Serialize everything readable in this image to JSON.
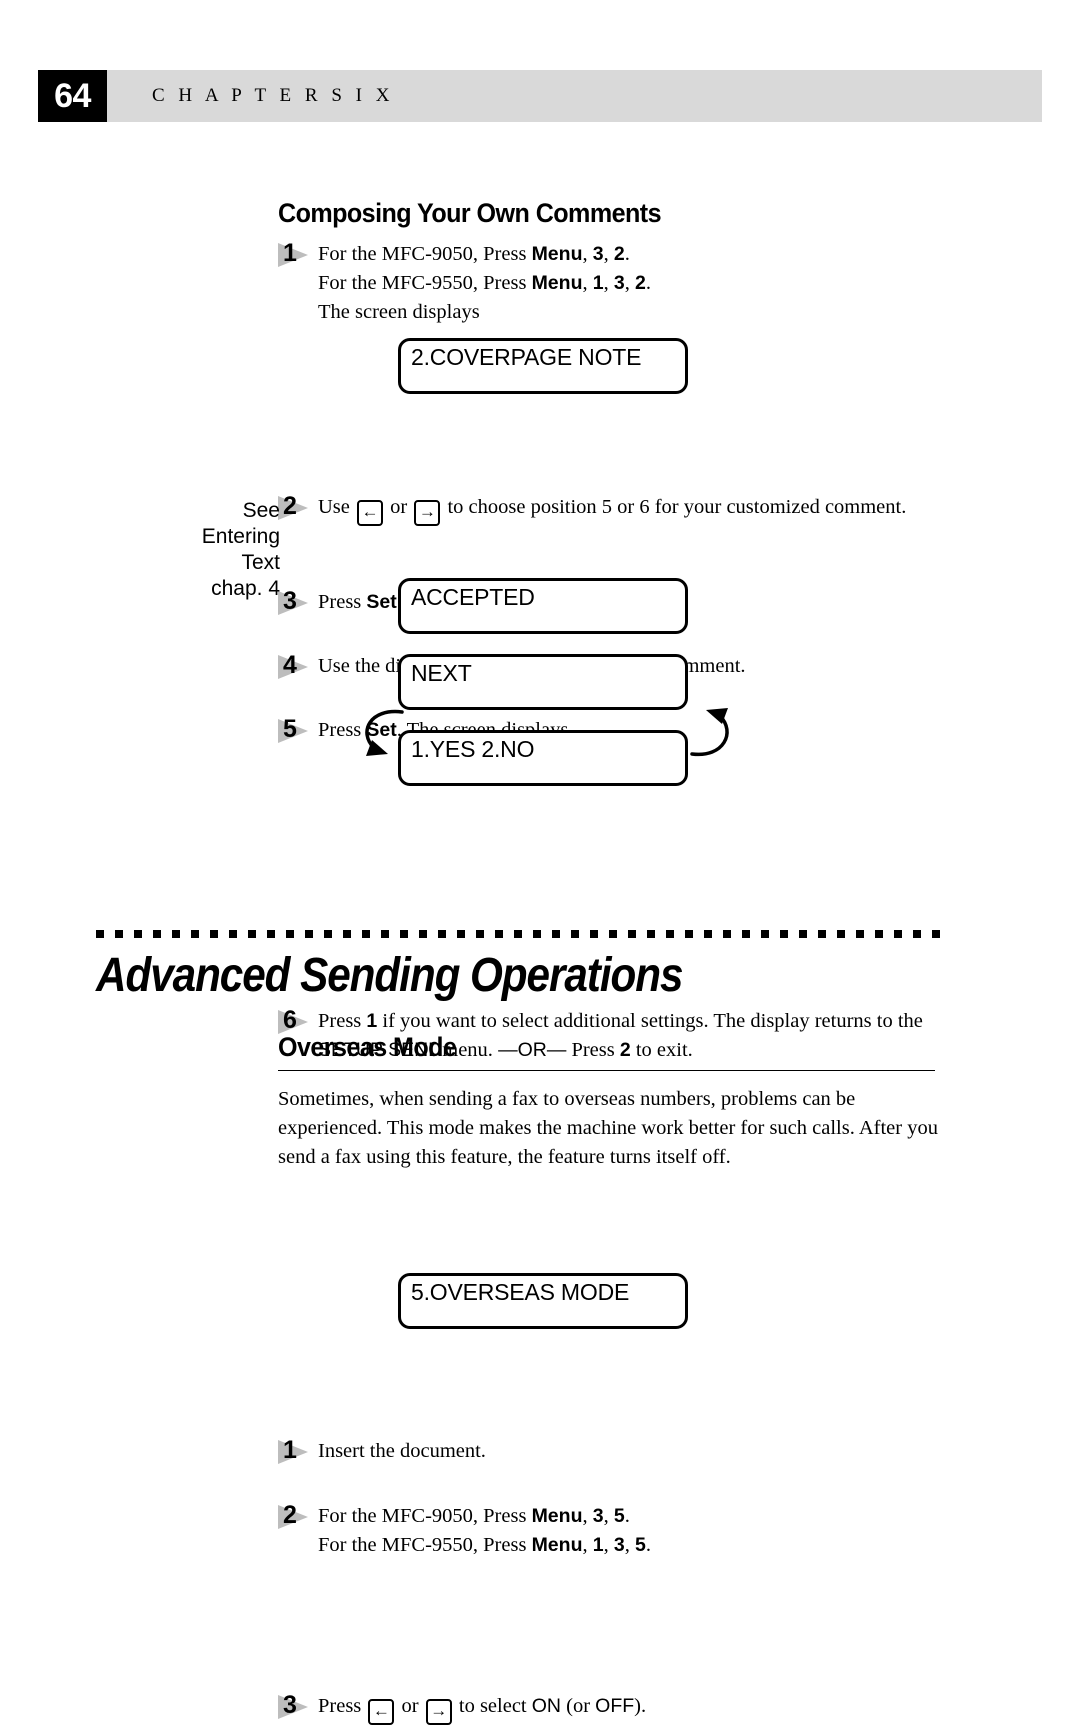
{
  "header": {
    "page_number": "64",
    "chapter_label": "C H A P T E R   S I X"
  },
  "sections": {
    "composing": {
      "heading": "Composing Your Own Comments",
      "steps": {
        "s1": {
          "num": "1",
          "line1_a": "For the MFC-9050, Press ",
          "line1_menu": "Menu",
          "line1_b": ", ",
          "line1_k1": "3",
          "line1_c": ", ",
          "line1_k2": "2",
          "line1_d": ".",
          "line2_a": "For the MFC-9550, Press ",
          "line2_menu": "Menu",
          "line2_b": ", ",
          "line2_k1": "1",
          "line2_c": ", ",
          "line2_k2": "3",
          "line2_d": ", ",
          "line2_k3": "2",
          "line2_e": ".",
          "line3": "The screen displays"
        },
        "s2": {
          "num": "2",
          "a": "Use ",
          "key_left": "←",
          "b": " or ",
          "key_right": "→",
          "c": " to choose position 5 or 6 for your customized comment."
        },
        "s3": {
          "num": "3",
          "a": "Press ",
          "set": "Set",
          "b": "."
        },
        "s4": {
          "num": "4",
          "a": "Use the dial pad to enter your customized comment."
        },
        "s5": {
          "num": "5",
          "a": "Press ",
          "set": "Set",
          "b": ". The screen displays"
        },
        "s6": {
          "num": "6",
          "a": "Press ",
          "k1": "1",
          "b": " if you want to select additional settings. The display returns to the ",
          "menu_name": "SETUP SEND",
          "c": "menu. ",
          "or": "—OR—",
          "d": " Press ",
          "k2": "2",
          "e": " to exit."
        }
      },
      "lcd_coverpage": "2.COVERPAGE NOTE",
      "lcd_accepted": "ACCEPTED",
      "lcd_next": "NEXT",
      "lcd_yesno": "1.YES 2.NO"
    },
    "margin_note": {
      "line1": "See",
      "line2": "Entering",
      "line3": "Text",
      "line4": "chap. 4"
    },
    "chapter_title": "Advanced Sending Operations",
    "overseas": {
      "heading": "Overseas Mode",
      "intro": "Sometimes, when sending a fax to overseas numbers, problems can be experienced. This mode makes the machine work better for such calls. After you send a fax using this feature, the feature turns itself off.",
      "steps": {
        "s1": {
          "num": "1",
          "a": "Insert the document."
        },
        "s2": {
          "num": "2",
          "line1_a": "For the MFC-9050, Press ",
          "line1_menu": "Menu",
          "line1_b": ", ",
          "line1_k1": "3",
          "line1_c": ", ",
          "line1_k2": "5",
          "line1_d": ".",
          "line2_a": "For the MFC-9550, Press ",
          "line2_menu": "Menu",
          "line2_b": ", ",
          "line2_k1": "1",
          "line2_c": ", ",
          "line2_k2": "3",
          "line2_d": ", ",
          "line2_k3": "5",
          "line2_e": "."
        },
        "s3": {
          "num": "3",
          "a": "Press ",
          "key_left": "←",
          "b": " or ",
          "key_right": "→",
          "c": " to select ",
          "on": "ON",
          "d": " (or ",
          "off": "OFF",
          "e": ")."
        }
      },
      "lcd_overseas": "5.OVERSEAS MODE"
    }
  },
  "colors": {
    "header_bar": "#d9d9d9",
    "page_box": "#000000",
    "marker_grey": "#bdbdbd"
  }
}
